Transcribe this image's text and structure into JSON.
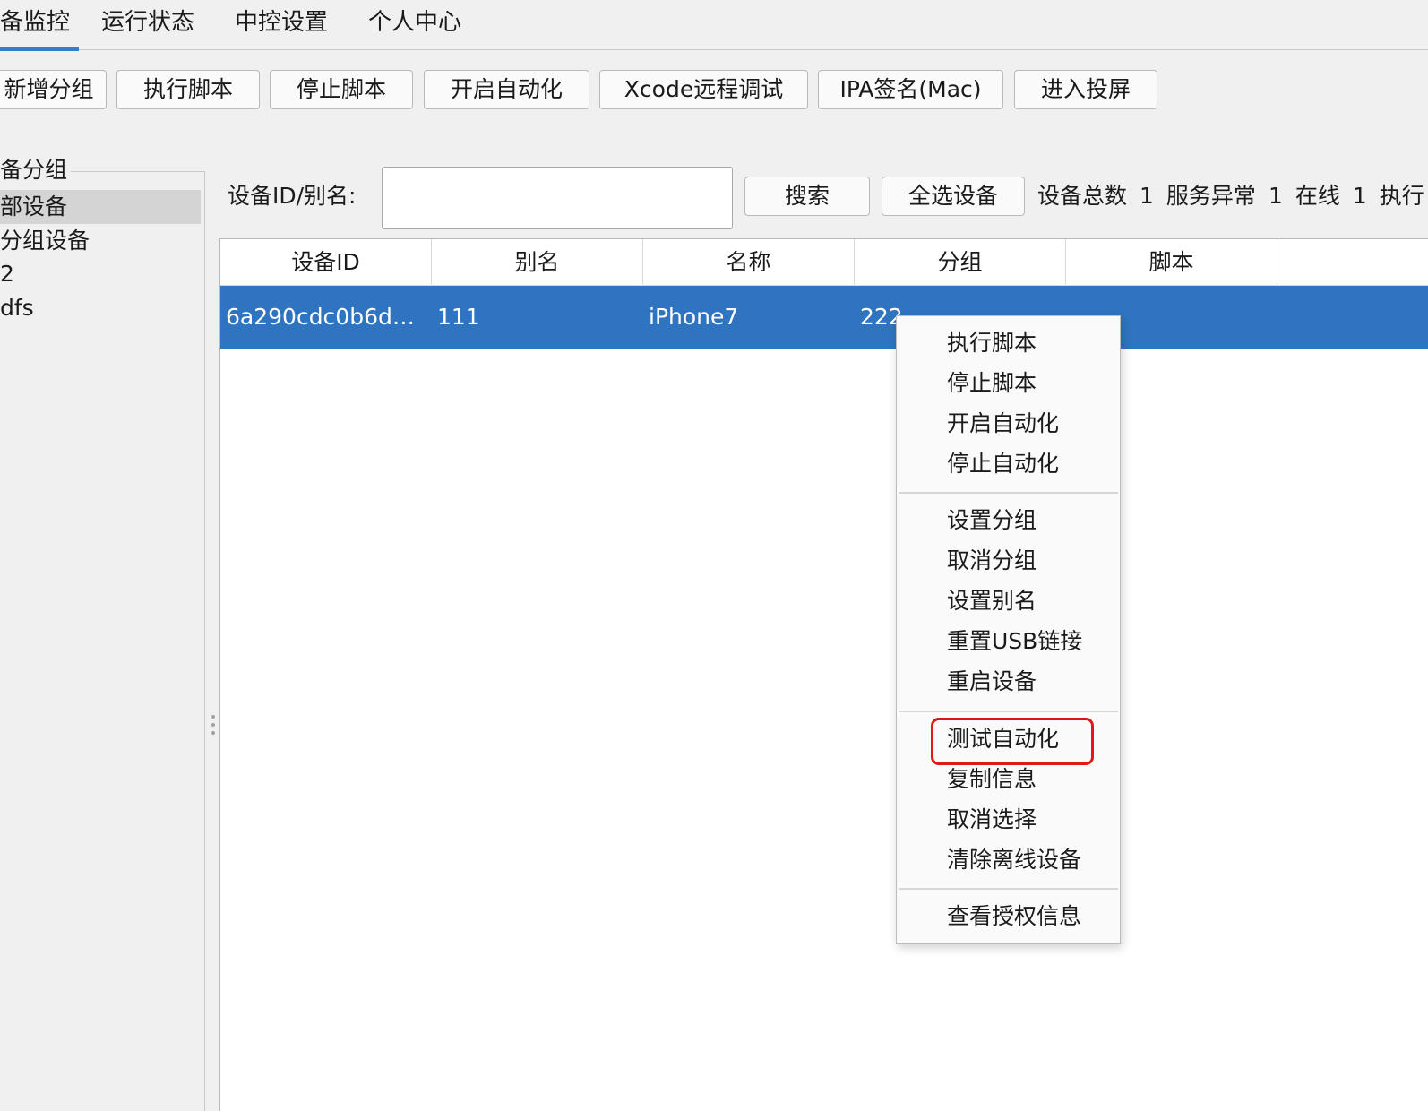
{
  "tabs": [
    "备监控",
    "运行状态",
    "中控设置",
    "个人中心"
  ],
  "toolbar": [
    "新增分组",
    "执行脚本",
    "停止脚本",
    "开启自动化",
    "Xcode远程调试",
    "IPA签名(Mac)",
    "进入投屏"
  ],
  "groups": {
    "title": "备分组",
    "items": [
      "部设备",
      "分组设备",
      "2",
      "dfs"
    ]
  },
  "search": {
    "label": "设备ID/别名:",
    "value": "",
    "search_button": "搜索",
    "select_all_button": "全选设备"
  },
  "stats": {
    "total_label": "设备总数",
    "total": "1",
    "error_label": "服务异常",
    "error": "1",
    "online_label": "在线",
    "online": "1",
    "running_label": "执行"
  },
  "table": {
    "columns": [
      "设备ID",
      "别名",
      "名称",
      "分组",
      "脚本"
    ],
    "rows": [
      {
        "device_id": "6a290cdc0b6db0...",
        "alias": "111",
        "name": "iPhone7",
        "group": "222"
      }
    ]
  },
  "context_menu": {
    "sections": [
      [
        "执行脚本",
        "停止脚本",
        "开启自动化",
        "停止自动化"
      ],
      [
        "设置分组",
        "取消分组",
        "设置别名",
        "重置USB链接",
        "重启设备"
      ],
      [
        "测试自动化",
        "复制信息",
        "取消选择",
        "清除离线设备"
      ],
      [
        "查看授权信息"
      ]
    ],
    "highlighted": "测试自动化"
  },
  "colors": {
    "accent": "#2f7fd0",
    "selected_row": "#2f74c0",
    "highlight_box": "#e21818"
  }
}
